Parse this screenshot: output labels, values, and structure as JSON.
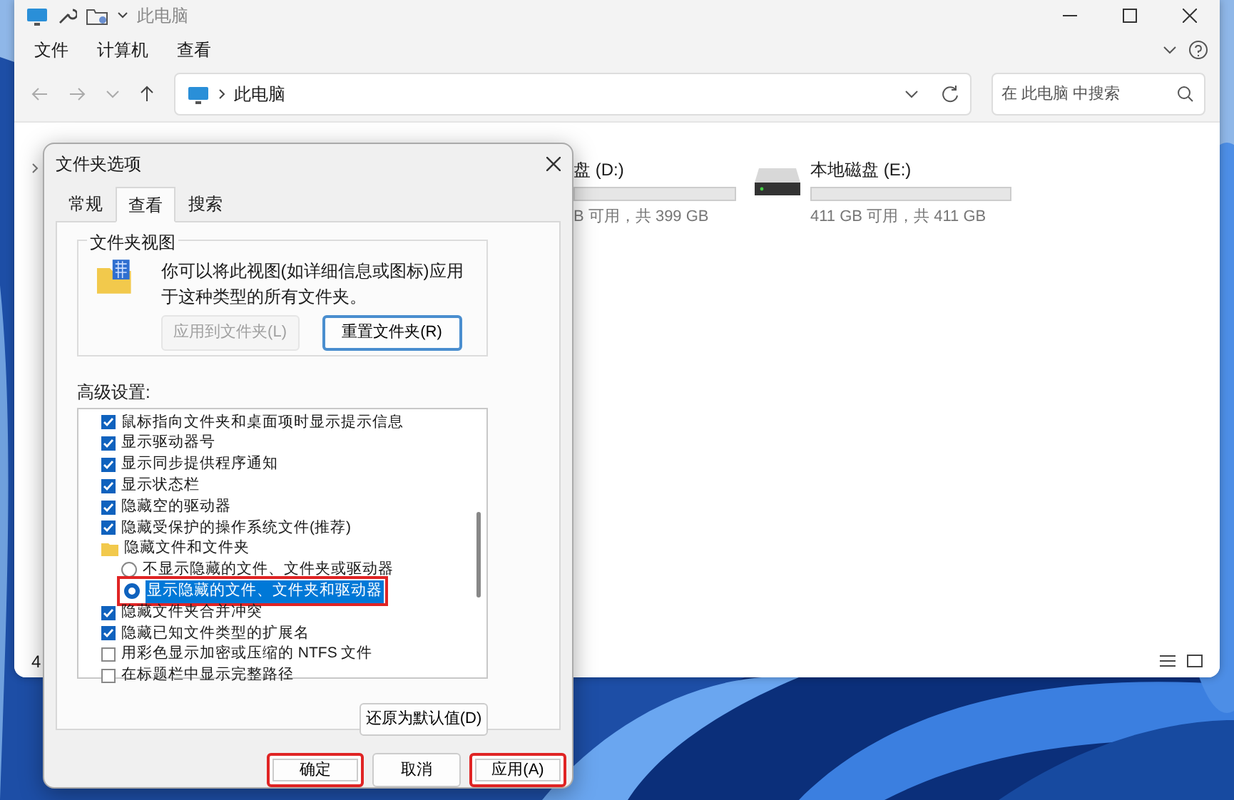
{
  "explorer": {
    "title": "此电脑",
    "menu": [
      "文件",
      "计算机",
      "查看"
    ],
    "address": "此电脑",
    "search": {
      "placeholder": "在 此电脑 中搜索"
    },
    "drives": [
      {
        "kind": "partial",
        "name": "盘 (D:)",
        "level": 0,
        "free": "B 可用，共 399 GB"
      },
      {
        "kind": "full",
        "name": "本地磁盘 (E:)",
        "level": 0,
        "free": "411 GB 可用，共 411 GB"
      }
    ],
    "status": "4"
  },
  "dialog": {
    "title": "文件夹选项",
    "tabs": [
      {
        "label": "常规",
        "selected": false
      },
      {
        "label": "查看",
        "selected": true
      },
      {
        "label": "搜索",
        "selected": false
      }
    ],
    "group_title": "文件夹视图",
    "description": "你可以将此视图(如详细信息或图标)应用于这种类型的所有文件夹。",
    "group_buttons": [
      {
        "label": "应用到文件夹(L)",
        "disabled": true
      },
      {
        "label": "重置文件夹(R)",
        "disabled": false
      }
    ],
    "advanced_label": "高级设置:",
    "settings": [
      {
        "kind": "checkbox",
        "label": "鼠标指向文件夹和桌面项时显示提示信息",
        "checked": true
      },
      {
        "kind": "checkbox",
        "label": "显示驱动器号",
        "checked": true
      },
      {
        "kind": "checkbox",
        "label": "显示同步提供程序通知",
        "checked": true
      },
      {
        "kind": "checkbox",
        "label": "显示状态栏",
        "checked": true
      },
      {
        "kind": "checkbox",
        "label": "隐藏空的驱动器",
        "checked": true
      },
      {
        "kind": "checkbox",
        "label": "隐藏受保护的操作系统文件(推荐)",
        "checked": true
      },
      {
        "kind": "folder",
        "label": "隐藏文件和文件夹",
        "children": [
          {
            "kind": "radio",
            "label": "不显示隐藏的文件、文件夹或驱动器",
            "selected": false,
            "highlighted": false
          },
          {
            "kind": "radio",
            "label": "显示隐藏的文件、文件夹和驱动器",
            "selected": true,
            "highlighted": true
          }
        ]
      },
      {
        "kind": "checkbox",
        "label": "隐藏文件夹合并冲突",
        "checked": true
      },
      {
        "kind": "checkbox",
        "label": "隐藏已知文件类型的扩展名",
        "checked": true
      },
      {
        "kind": "checkbox",
        "label": "用彩色显示加密或压缩的 NTFS 文件",
        "checked": false
      },
      {
        "kind": "checkbox",
        "label": "在标题栏中显示完整路径",
        "checked": false
      }
    ],
    "restore_button": "还原为默认值(D)",
    "footer_buttons": [
      {
        "label": "确定",
        "highlighted": true
      },
      {
        "label": "取消",
        "highlighted": false
      },
      {
        "label": "应用(A)",
        "highlighted": true
      }
    ]
  }
}
